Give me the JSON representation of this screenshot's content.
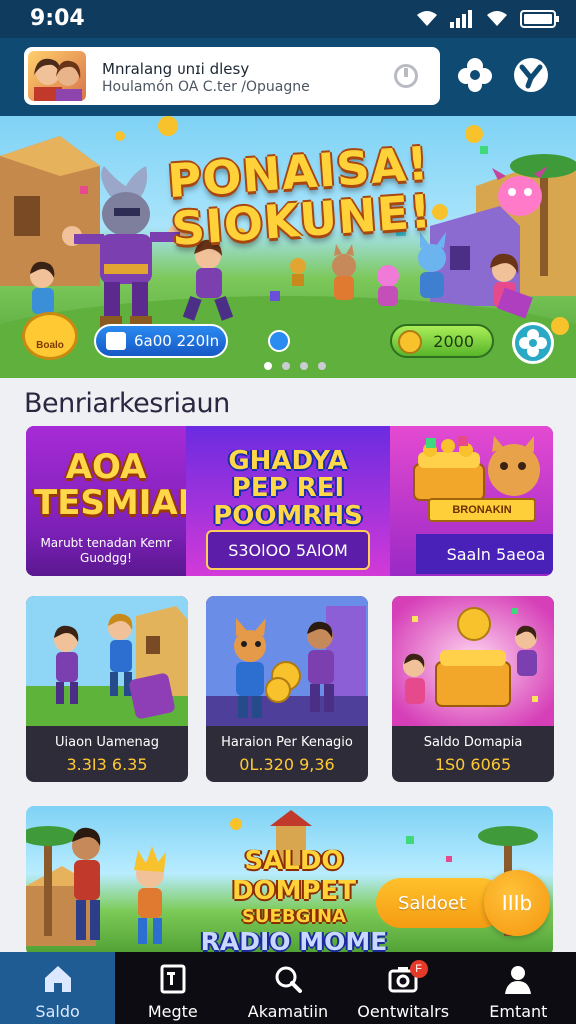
{
  "status_bar": {
    "time": "9:04"
  },
  "header": {
    "profile_name": "Mnralang ᴜnɪi dlesy",
    "profile_sub": "Houlamón OA C.ter /Opuagne"
  },
  "hero": {
    "title_line1": "PONAISA!",
    "title_line2": "SIOKUNE!",
    "left_pill": "6a00 220In",
    "right_pill": "2000",
    "badge": "Boalo"
  },
  "section": {
    "title": "Benriarkesriaun"
  },
  "promo": {
    "panel1_title": "AOA TESMIAN",
    "panel1_caption": "Marubt tenadan Kemr Guodgg!",
    "panel2_title": "GHADYA PEP REI POOMRHS",
    "panel2_box": "S3OlOO 5AlOM",
    "panel3_ribbon": "BRONAKIN",
    "panel3_button": "Saaln 5aeoa"
  },
  "cards": [
    {
      "label": "Uiaon Uamenag",
      "value": "3.3I3 6.35"
    },
    {
      "label": "Haraion Per Kenagio",
      "value": "0L.320 9,36"
    },
    {
      "label": "Saldo Domapia",
      "value": "1S0 6065"
    }
  ],
  "bottom_banner": {
    "line1": "SALDO DOMPET",
    "line2": "SUEBGINA",
    "line3": "RADIO MOME",
    "button": "Saldoet",
    "fab": "IIIb"
  },
  "nav": [
    {
      "label": "Saldo",
      "icon": "home-icon"
    },
    {
      "label": "Megte",
      "icon": "document-icon"
    },
    {
      "label": "Akamatiin",
      "icon": "search-icon"
    },
    {
      "label": "Oentwitalrs",
      "icon": "camera-icon",
      "badge": "F"
    },
    {
      "label": "Emtant",
      "icon": "user-icon"
    }
  ],
  "colors": {
    "header": "#0f4a73",
    "nav_active": "#1f5c94",
    "accent_gold": "#ffc933"
  }
}
